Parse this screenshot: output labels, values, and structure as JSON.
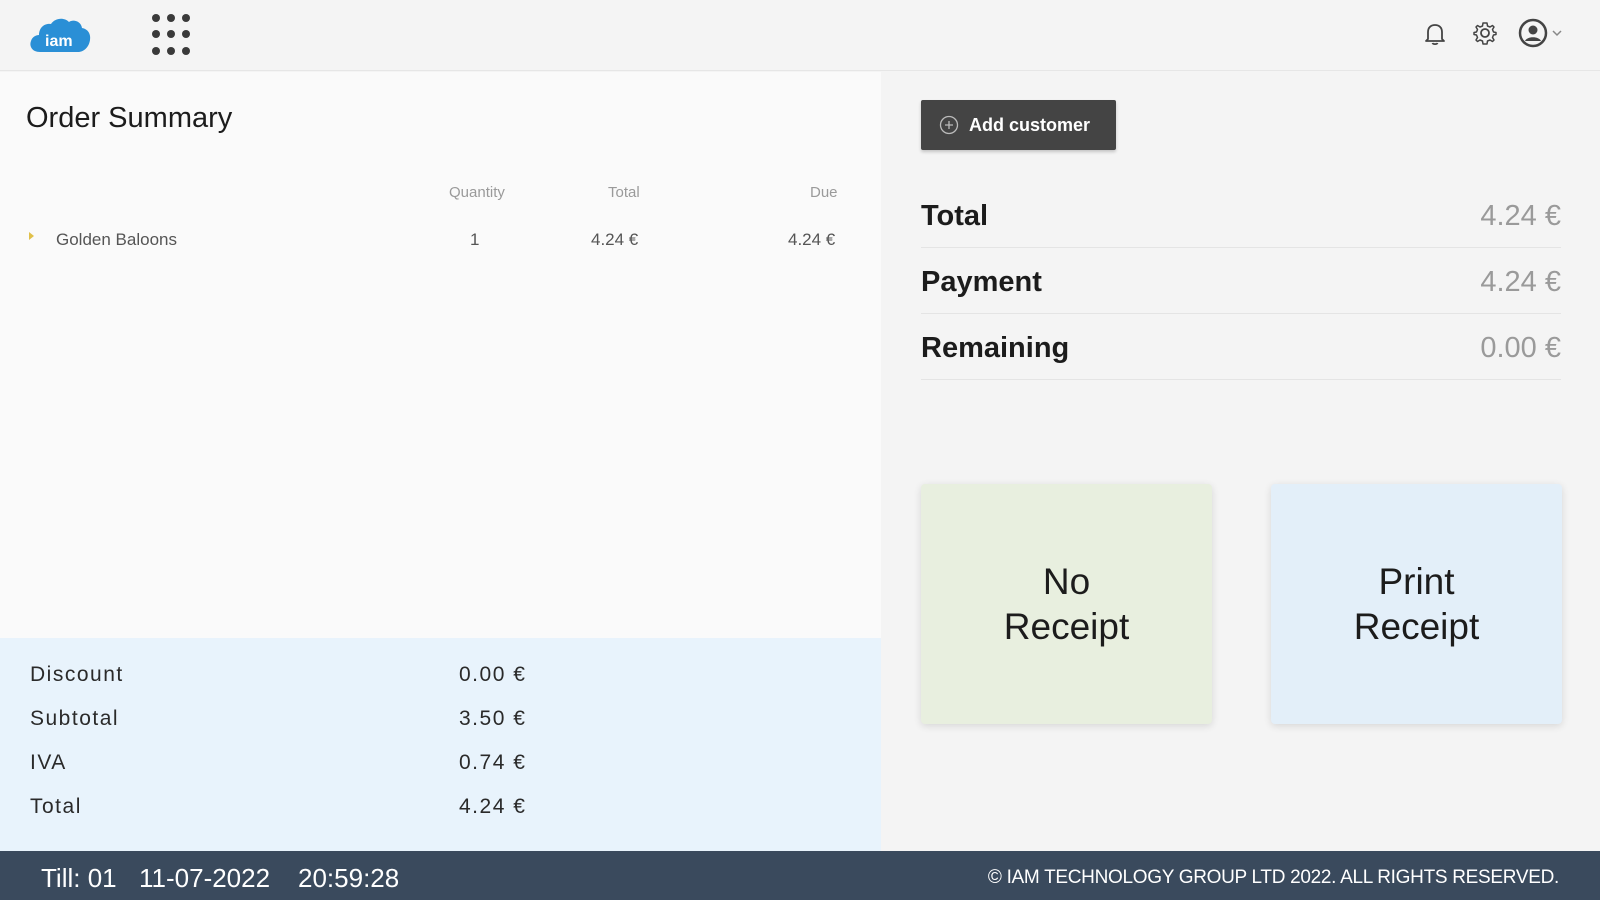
{
  "header": {
    "logo_text": "iam",
    "icons": [
      "apps-grid-icon",
      "bell-icon",
      "gear-icon",
      "user-avatar-icon",
      "chevron-down-icon"
    ]
  },
  "order": {
    "title": "Order Summary",
    "columns": {
      "quantity": "Quantity",
      "total": "Total",
      "due": "Due"
    },
    "items": [
      {
        "name": "Golden Baloons",
        "quantity": "1",
        "total": "4.24 €",
        "due": "4.24 €"
      }
    ]
  },
  "totals": {
    "discount_label": "Discount",
    "discount_value": "0.00 €",
    "subtotal_label": "Subtotal",
    "subtotal_value": "3.50 €",
    "iva_label": "IVA",
    "iva_value": "0.74 €",
    "total_label": "Total",
    "total_value": "4.24 €"
  },
  "payment": {
    "add_customer_label": "Add customer",
    "total_label": "Total",
    "total_value": "4.24 €",
    "payment_label": "Payment",
    "payment_value": "4.24 €",
    "remaining_label": "Remaining",
    "remaining_value": "0.00 €",
    "no_receipt_line1": "No",
    "no_receipt_line2": "Receipt",
    "print_receipt_line1": "Print",
    "print_receipt_line2": "Receipt"
  },
  "footer": {
    "till": "Till: 01",
    "date": "11-07-2022",
    "time": "20:59:28",
    "copyright": "© IAM TECHNOLOGY GROUP LTD 2022. ALL RIGHTS RESERVED."
  },
  "colors": {
    "logo_blue": "#2a8fd6",
    "footer_bg": "#3a4a5d",
    "totals_bg": "#e8f3fc",
    "no_receipt_bg": "#e8efdf",
    "print_receipt_bg": "#e3eff9",
    "button_dark": "#444444"
  }
}
